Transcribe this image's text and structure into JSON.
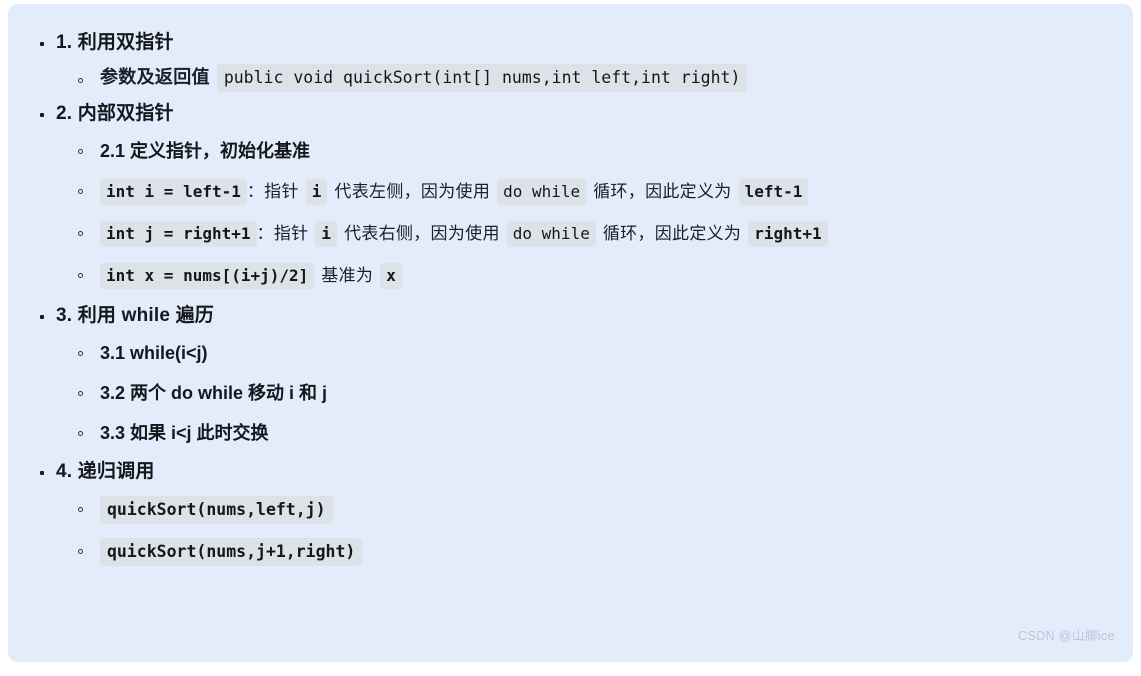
{
  "panel": {
    "background_color": "#e2ecfb",
    "code_span_color": "#dde2e9",
    "text_color": "#14181c"
  },
  "outline": {
    "item1": {
      "title": "1. 利用双指针",
      "sub1": {
        "label": "参数及返回值",
        "code": "public void quickSort(int[] nums,int left,int right)"
      }
    },
    "item2": {
      "title": "2. 内部双指针",
      "sub1": {
        "label": "2.1 定义指针，初始化基准"
      },
      "sub2": {
        "code_decl": "int i = left-1",
        "colon": "：",
        "text_a": "指针",
        "code_var": "i",
        "text_b": "代表左侧，因为使用",
        "code_loop": "do while",
        "text_c": "循环，因此定义为",
        "code_val": "left-1"
      },
      "sub3": {
        "code_decl": "int j = right+1",
        "colon": "：",
        "text_a": "指针",
        "code_var": "i",
        "text_b": "代表右侧，因为使用",
        "code_loop": "do while",
        "text_c": "循环，因此定义为",
        "code_val": "right+1"
      },
      "sub4": {
        "code_decl": "int x = nums[(i+j)/2]",
        "text_a": "基准为",
        "code_var": "x"
      }
    },
    "item3": {
      "title": "3. 利用 while 遍历",
      "sub1": {
        "label": "3.1 while(i<j)"
      },
      "sub2": {
        "label": "3.2 两个 do while 移动 i 和 j"
      },
      "sub3": {
        "label": "3.3 如果 i<j 此时交换"
      }
    },
    "item4": {
      "title": "4. 递归调用",
      "sub1": {
        "code": "quickSort(nums,left,j)"
      },
      "sub2": {
        "code": "quickSort(nums,j+1,right)"
      }
    }
  },
  "watermark": {
    "text": "CSDN @山脚ice"
  }
}
